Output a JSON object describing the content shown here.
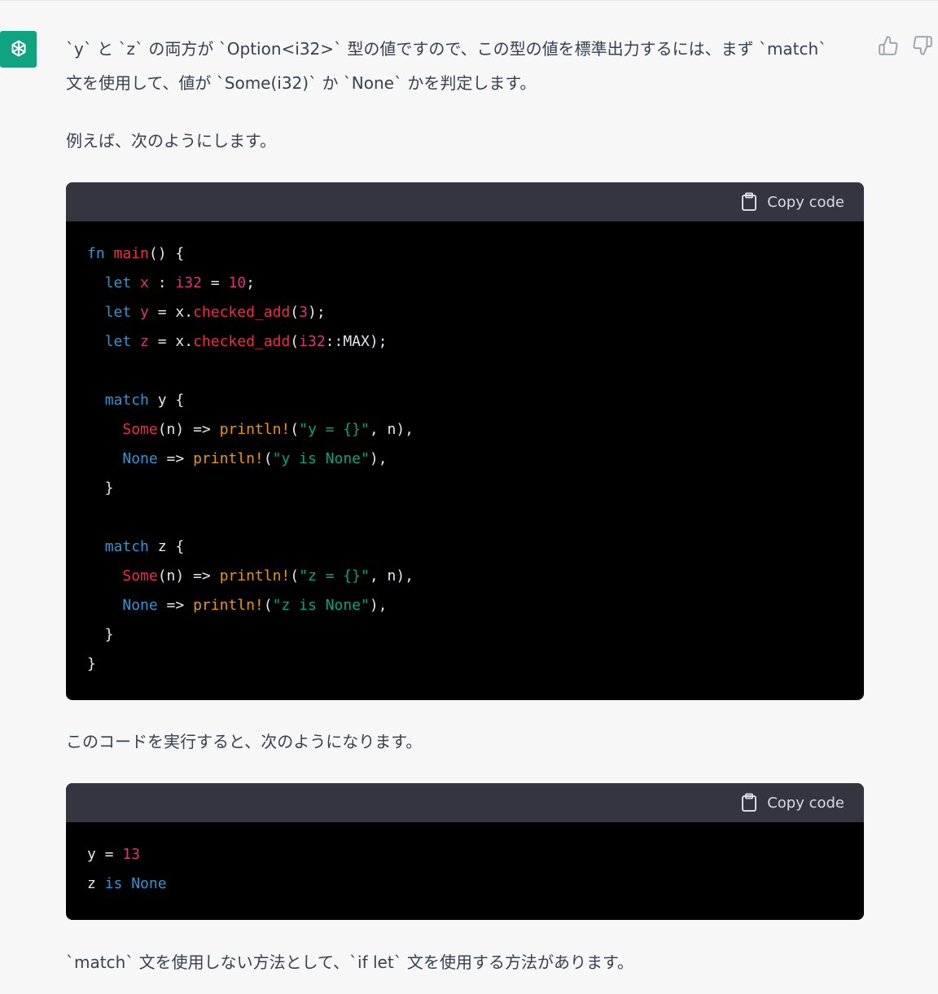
{
  "message": {
    "p1_line1_a": "`y` と `z` の両方が `Option<i32>` 型の値ですので、この型の値を標準出力するには、まず `match`",
    "p1_line2": "文を使用して、値が `Some(i32)` か `None` かを判定します。",
    "p2": "例えば、次のようにします。",
    "p3": "このコードを実行すると、次のようになります。",
    "p4": "`match` 文を使用しない方法として、`if let` 文を使用する方法があります。"
  },
  "codeblock1": {
    "copy_label": "Copy code"
  },
  "codeblock2": {
    "copy_label": "Copy code"
  },
  "icons": {
    "avatar": "openai-logo-icon",
    "thumbs_up": "thumbs-up-icon",
    "thumbs_down": "thumbs-down-icon",
    "copy": "clipboard-icon"
  },
  "colors": {
    "avatar_bg": "#10a37f",
    "code_header_bg": "#343541",
    "code_bg": "#000000"
  }
}
